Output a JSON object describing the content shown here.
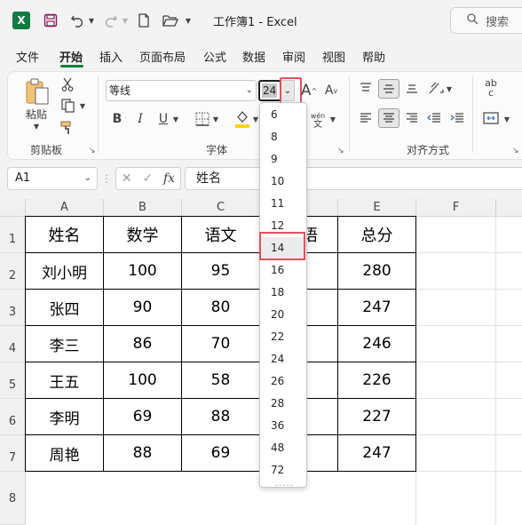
{
  "titlebar": {
    "app_icon": "excel-logo",
    "app_letter": "X",
    "title": "工作簿1  -  Excel",
    "search_placeholder": "搜索"
  },
  "tabs": [
    "文件",
    "开始",
    "插入",
    "页面布局",
    "公式",
    "数据",
    "审阅",
    "视图",
    "帮助"
  ],
  "active_tab": "开始",
  "ribbon": {
    "clipboard": {
      "paste_label": "粘贴",
      "group_label": "剪贴板"
    },
    "font": {
      "font_name": "等线",
      "font_size": "24",
      "group_label": "字体",
      "bold": "B",
      "italic": "I",
      "underline": "U",
      "grow": "A",
      "shrink": "A",
      "phonetic_top": "wén",
      "phonetic_bottom": "文"
    },
    "alignment": {
      "group_label": "对齐方式",
      "wrap_top": "ab",
      "wrap_bottom": "c"
    }
  },
  "formula_bar": {
    "name_box": "A1",
    "fx": "fx",
    "content": "姓名"
  },
  "columns": [
    "A",
    "B",
    "C",
    "D",
    "E",
    "F"
  ],
  "rows": [
    "1",
    "2",
    "3",
    "4",
    "5",
    "6",
    "7",
    "8"
  ],
  "table": {
    "headers": [
      "姓名",
      "数学",
      "语文",
      "语",
      "总分"
    ],
    "data": [
      [
        "刘小明",
        "100",
        "95",
        "280"
      ],
      [
        "张四",
        "90",
        "80",
        "247"
      ],
      [
        "李三",
        "86",
        "70",
        "246"
      ],
      [
        "王五",
        "100",
        "58",
        "226"
      ],
      [
        "李明",
        "69",
        "88",
        "227"
      ],
      [
        "周艳",
        "88",
        "69",
        "247"
      ]
    ]
  },
  "font_size_dropdown": {
    "options": [
      "6",
      "8",
      "9",
      "10",
      "11",
      "12",
      "14",
      "16",
      "18",
      "20",
      "22",
      "24",
      "26",
      "28",
      "36",
      "48",
      "72"
    ],
    "highlighted": "14",
    "grip": "....."
  },
  "colors": {
    "excel_green": "#107c41",
    "highlight_red": "#e0505f",
    "fill_yellow": "#ffd400",
    "font_red": "#e81123"
  }
}
